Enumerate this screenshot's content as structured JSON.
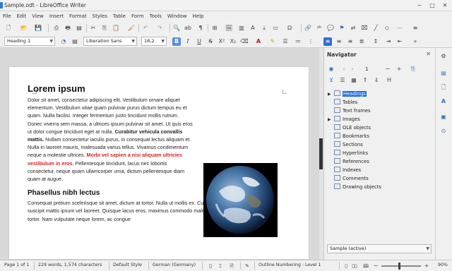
{
  "window": {
    "title": "Sample.odt - LibreOffice Writer"
  },
  "menu": [
    "File",
    "Edit",
    "View",
    "Insert",
    "Format",
    "Styles",
    "Table",
    "Form",
    "Tools",
    "Window",
    "Help"
  ],
  "formatting": {
    "paragraph_style": "Heading 1",
    "font_name": "Liberation Sans",
    "font_size": "18,2"
  },
  "document": {
    "heading1": "Lorem ipsum",
    "p1_a": "Dolor sit amet, consectetur adipiscing elit. Vestibulum ornare aliquet elementum. Vestibulum vitae quam pulvinar purus dictum tempus eu et quam. Nulla facilisi. Integer fermentum justo tincidunt mollis rutrum. Donec viverra sem massa, a ultrices ipsum pulvinar sit amet. Ut quis eros ut dolor congue tincidunt eget at nulla. ",
    "p1_bold": "Curabitur vehicula convallis mattis.",
    "p1_b": " Nullam consectetur iaculis purus, in consequat lectus aliquam et. Nulla in laoreet mauris, malesuada varius tellus. Vivamus condimentum neque a molestie ultrices. ",
    "p1_red": "Morbi vel sapien a nisi aliquam ultricies vestibulum in eros.",
    "p1_c": " Pellentesque tincidunt, lacus nec lobortis consectetur, neque quam ullamcorper urna, dictum pellentesque diam quam at augue.",
    "heading2": "Phasellus nibh lectus",
    "p2": "Consequat pretium scelerisque sit amet, dictum at tortor. Nulla ut mollis ex. Curabitur sed odio massa. Cras suscipit mattis ipsum vel laoreet. Quisque lacus eros, maximus commodo malesuada ut, commodo quis tortor. Nam vulputate neque lorem, ac congue"
  },
  "navigator": {
    "title": "Navigator",
    "page_number": "1",
    "items": [
      {
        "label": "Headings",
        "expandable": true,
        "selected": true
      },
      {
        "label": "Tables",
        "expandable": false
      },
      {
        "label": "Text frames",
        "expandable": false
      },
      {
        "label": "Images",
        "expandable": true
      },
      {
        "label": "OLE objects",
        "expandable": false
      },
      {
        "label": "Bookmarks",
        "expandable": false
      },
      {
        "label": "Sections",
        "expandable": false
      },
      {
        "label": "Hyperlinks",
        "expandable": false
      },
      {
        "label": "References",
        "expandable": false
      },
      {
        "label": "Indexes",
        "expandable": false
      },
      {
        "label": "Comments",
        "expandable": false
      },
      {
        "label": "Drawing objects",
        "expandable": false
      }
    ],
    "document_select": "Sample (active)"
  },
  "status": {
    "page": "Page 1 of 1",
    "words": "229 words, 1,574 characters",
    "style": "Default Style",
    "language": "German (Germany)",
    "outline": "Outline Numbering : Level 1",
    "zoom": "90%"
  },
  "colors": {
    "accent": "#1e6fd9",
    "red_text": "#d92020"
  }
}
